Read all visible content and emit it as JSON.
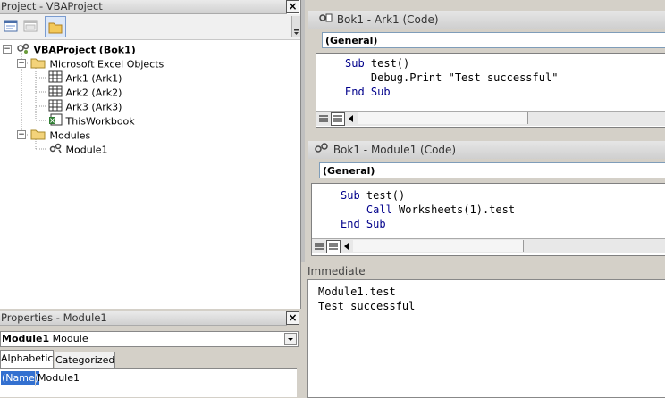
{
  "project_panel": {
    "title": "Project - VBAProject",
    "close": "×",
    "toolbar": {
      "view_code_icon": "view-code-icon",
      "view_object_icon": "view-object-icon",
      "toggle_folders_icon": "folder-icon"
    },
    "tree": {
      "root": "VBAProject (Bok1)",
      "excel_objects": "Microsoft Excel Objects",
      "sheets": [
        "Ark1 (Ark1)",
        "Ark2 (Ark2)",
        "Ark3 (Ark3)"
      ],
      "workbook": "ThisWorkbook",
      "modules_folder": "Modules",
      "module": "Module1"
    }
  },
  "code_window_1": {
    "title": "Bok1 - Ark1 (Code)",
    "combo": "(General)",
    "lines": [
      {
        "kw": "Sub",
        "text": " test()"
      },
      {
        "kw": "",
        "text": "    Debug.Print \"Test successful\""
      },
      {
        "kw": "End Sub",
        "text": ""
      }
    ]
  },
  "code_window_2": {
    "title": "Bok1 - Module1 (Code)",
    "combo": "(General)",
    "lines": [
      {
        "kw": "Sub",
        "text": " test()"
      },
      {
        "kw": "    Call",
        "text": " Worksheets(1).test"
      },
      {
        "kw": "End Sub",
        "text": ""
      }
    ]
  },
  "immediate": {
    "title": "Immediate",
    "lines": [
      "Module1.test",
      "Test successful"
    ]
  },
  "properties_panel": {
    "title": "Properties - Module1",
    "close": "×",
    "object_name": "Module1",
    "object_type": "Module",
    "tabs": [
      "Alphabetic",
      "Categorized"
    ],
    "rows": [
      {
        "name": "(Name)",
        "value": "Module1"
      }
    ]
  }
}
